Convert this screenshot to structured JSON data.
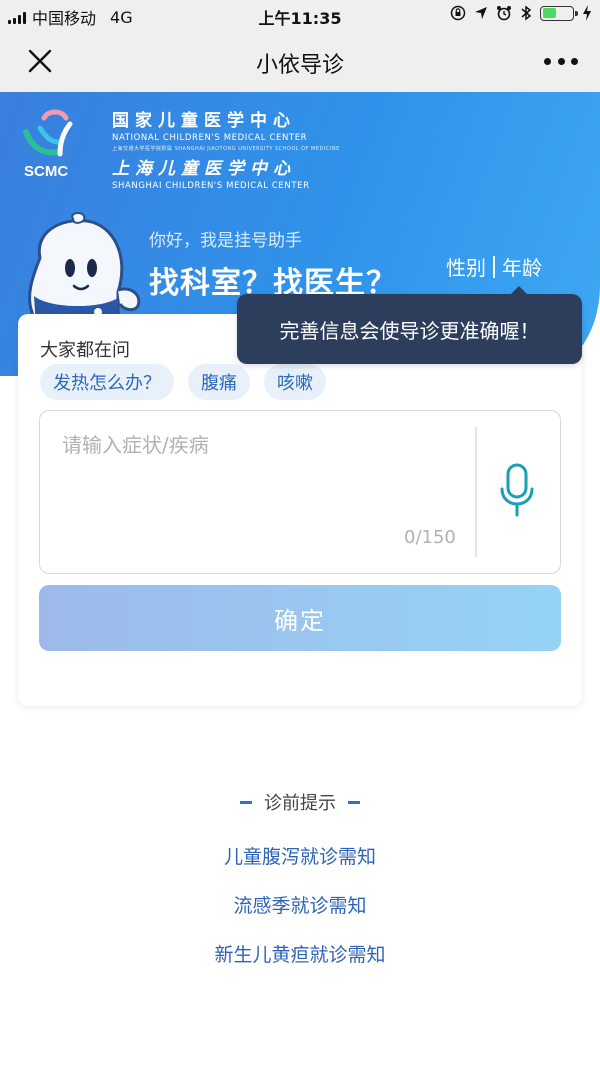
{
  "status_bar": {
    "carrier": "中国移动",
    "network": "4G",
    "time": "上午11:35",
    "battery_color": "#4cd964"
  },
  "nav": {
    "title": "小依导诊",
    "close_icon": "close-icon",
    "more_icon": "more-icon"
  },
  "banner": {
    "logo_abbr": "SCMC",
    "logo_cn_1": "国家儿童医学中心",
    "logo_en_1": "NATIONAL CHILDREN'S MEDICAL CENTER",
    "logo_sub": "上海交通大学医学院附属  SHANGHAI JIAOTONG UNIVERSITY SCHOOL OF MEDICINE",
    "logo_cn_2": "上海儿童医学中心",
    "logo_en_2": "SHANGHAI CHILDREN'S MEDICAL CENTER",
    "greeting": "你好，我是挂号助手",
    "headline": "找科室？找医生？",
    "gender_link": "性别",
    "age_link": "年龄",
    "tooltip": "完善信息会使导诊更准确喔！"
  },
  "card": {
    "ask_label": "大家都在问",
    "chips": [
      "发热怎么办？",
      "腹痛",
      "咳嗽"
    ],
    "input_placeholder": "请输入症状/疾病",
    "counter": "0/150",
    "confirm_label": "确定"
  },
  "tips": {
    "title": "诊前提示",
    "links": [
      "儿童腹泻就诊需知",
      "流感季就诊需知",
      "新生儿黄疸就诊需知"
    ]
  },
  "colors": {
    "banner_start": "#3a7fdd",
    "banner_end": "#3ea8f4",
    "tooltip_bg": "#2d3e5c",
    "chip_text": "#2c69b8",
    "link_text": "#2f63b8",
    "mic_color": "#1a9fb4"
  }
}
